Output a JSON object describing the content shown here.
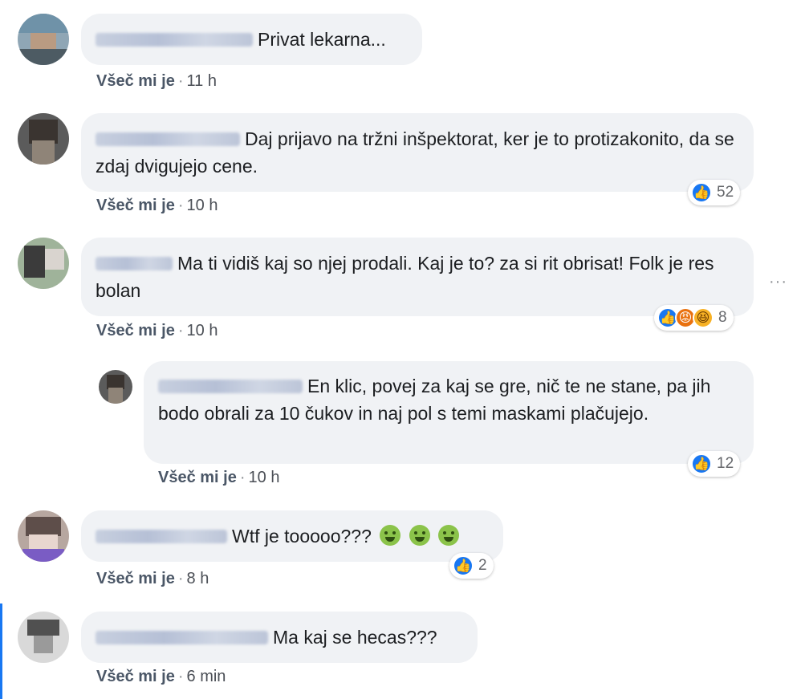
{
  "comments": [
    {
      "text": "Privat lekarna...",
      "like": "Všeč mi je",
      "sep": "·",
      "time": "11 h"
    },
    {
      "text": "Daj prijavo na tržni inšpektorat, ker je to protizakonito, da se zdaj dvigujejo cene.",
      "like": "Všeč mi je",
      "sep": "·",
      "time": "10 h",
      "reactions": {
        "count": "52",
        "icons": [
          "like-icon"
        ]
      }
    },
    {
      "text": "Ma ti vidiš kaj so njej prodali. Kaj je to? za si rit obrisat! Folk je res bolan",
      "like": "Všeč mi je",
      "sep": "·",
      "time": "10 h",
      "reactions": {
        "count": "8",
        "icons": [
          "like-icon",
          "angry-icon",
          "haha-icon"
        ]
      }
    },
    {
      "text": "En klic, povej za kaj se gre, nič te ne stane, pa jih bodo obrali za 10 čukov in naj pol s temi maskami plačujejo.",
      "like": "Všeč mi je",
      "sep": "·",
      "time": "10 h",
      "reactions": {
        "count": "12",
        "icons": [
          "like-icon"
        ]
      }
    },
    {
      "text": "Wtf je tooooo???",
      "like": "Všeč mi je",
      "sep": "·",
      "time": "8 h",
      "reactions": {
        "count": "2",
        "icons": [
          "like-icon"
        ]
      },
      "emojis": [
        "nauseated-face-icon",
        "nauseated-face-icon",
        "nauseated-face-icon"
      ]
    },
    {
      "text": "Ma kaj se hecas???",
      "like": "Všeč mi je",
      "sep": "·",
      "time": "6 min"
    }
  ],
  "more_options": "···",
  "colors": {
    "bubble": "#f0f2f5",
    "like_blue": "#1877f2",
    "meta": "#4b4f56"
  }
}
